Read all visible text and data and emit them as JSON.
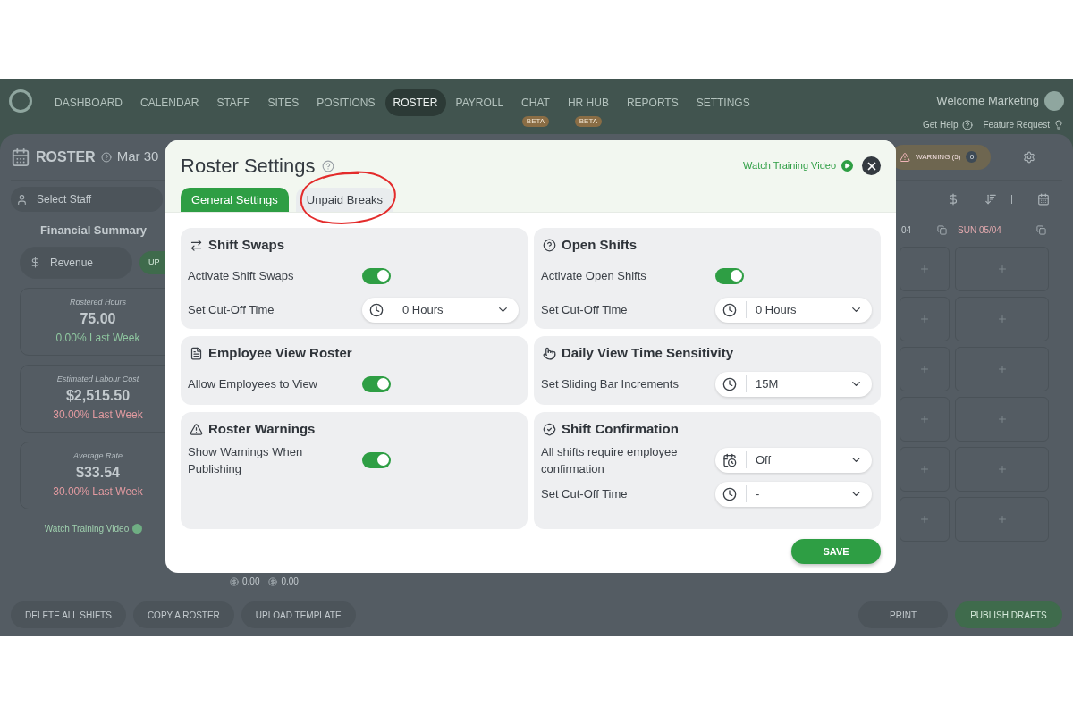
{
  "nav": {
    "items": [
      {
        "label": "DASHBOARD",
        "selected": false
      },
      {
        "label": "CALENDAR",
        "selected": false
      },
      {
        "label": "STAFF",
        "selected": false
      },
      {
        "label": "SITES",
        "selected": false
      },
      {
        "label": "POSITIONS",
        "selected": false
      },
      {
        "label": "ROSTER",
        "selected": true
      },
      {
        "label": "PAYROLL",
        "selected": false
      },
      {
        "label": "CHAT",
        "selected": false,
        "badge": "BETA"
      },
      {
        "label": "HR HUB",
        "selected": false,
        "badge": "BETA"
      },
      {
        "label": "REPORTS",
        "selected": false
      },
      {
        "label": "SETTINGS",
        "selected": false
      }
    ],
    "welcome": "Welcome Marketing",
    "get_help": "Get Help",
    "feature_request": "Feature Request"
  },
  "roster": {
    "title": "ROSTER",
    "date": "Mar 30",
    "select_staff": {
      "placeholder": "Select Staff"
    },
    "warning": {
      "label": "WARNING (5)",
      "count": "0"
    },
    "financial_summary": {
      "title": "Financial Summary",
      "revenue": {
        "placeholder": "Revenue"
      },
      "button": "UP",
      "stats": [
        {
          "label": "Rostered Hours",
          "value": "75.00",
          "change": "0.00% Last Week",
          "color": "#8fc7a0"
        },
        {
          "label": "Estimated Labour Cost",
          "value": "$2,515.50",
          "change": "30.00% Last Week",
          "color": "#e29aa0"
        },
        {
          "label": "Average Rate",
          "value": "$33.54",
          "change": "30.00% Last Week",
          "color": "#e29aa0"
        }
      ],
      "watch_link": "Watch Training Video"
    },
    "day_headers": [
      "04",
      "SUN 05/04"
    ],
    "totals": [
      "0.00",
      "0.00"
    ],
    "bottom_left": [
      "DELETE ALL SHIFTS",
      "COPY A ROSTER",
      "UPLOAD TEMPLATE"
    ],
    "bottom_right": [
      {
        "label": "PRINT",
        "kind": "plain"
      },
      {
        "label": "PUBLISH DRAFTS",
        "kind": "primary"
      }
    ]
  },
  "modal": {
    "title": "Roster Settings",
    "watch_link": "Watch Training Video",
    "tabs": [
      {
        "label": "General Settings",
        "selected": true
      },
      {
        "label": "Unpaid Breaks",
        "selected": false
      }
    ],
    "sections": [
      {
        "title": "Shift Swaps",
        "rows": [
          {
            "kind": "toggle",
            "label": "Activate Shift Swaps",
            "on": true
          },
          {
            "kind": "select",
            "label": "Set Cut-Off Time",
            "value": "0 Hours"
          }
        ]
      },
      {
        "title": "Open Shifts",
        "rows": [
          {
            "kind": "toggle",
            "label": "Activate Open Shifts",
            "on": true
          },
          {
            "kind": "select",
            "label": "Set Cut-Off Time",
            "value": "0 Hours"
          }
        ]
      },
      {
        "title": "Employee View Roster",
        "rows": [
          {
            "kind": "toggle",
            "label": "Allow Employees to View",
            "on": true
          }
        ]
      },
      {
        "title": "Daily View Time Sensitivity",
        "rows": [
          {
            "kind": "select",
            "label": "Set Sliding Bar Increments",
            "value": "15M"
          }
        ]
      },
      {
        "title": "Roster Warnings",
        "rows": [
          {
            "kind": "toggle",
            "label": "Show Warnings When Publishing",
            "on": true
          }
        ]
      },
      {
        "title": "Shift Confirmation",
        "rows": [
          {
            "kind": "select",
            "label": "All shifts require employee confirmation",
            "value": "Off"
          },
          {
            "kind": "select",
            "label": "Set Cut-Off Time",
            "value": "-"
          }
        ]
      }
    ],
    "save": "SAVE"
  }
}
